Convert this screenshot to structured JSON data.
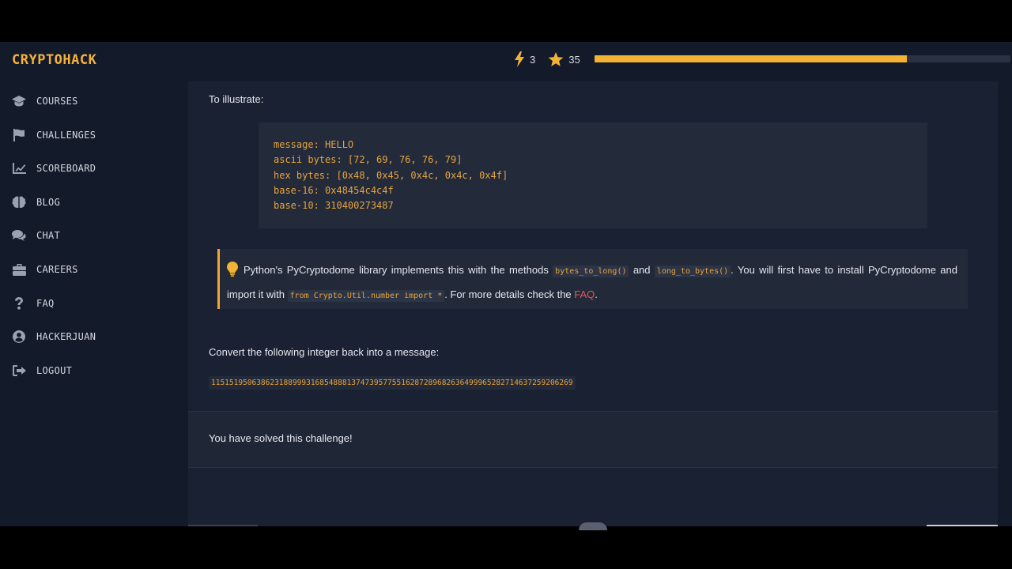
{
  "brand": "CRYPTOHACK",
  "stats": {
    "lightning": "3",
    "stars": "35",
    "progress_percent": 75
  },
  "nav": [
    {
      "label": "COURSES",
      "icon": "graduation-cap-icon"
    },
    {
      "label": "CHALLENGES",
      "icon": "flag-icon"
    },
    {
      "label": "SCOREBOARD",
      "icon": "chart-line-icon"
    },
    {
      "label": "BLOG",
      "icon": "brain-icon"
    },
    {
      "label": "CHAT",
      "icon": "chat-bubbles-icon"
    },
    {
      "label": "CAREERS",
      "icon": "briefcase-icon"
    },
    {
      "label": "FAQ",
      "icon": "question-mark-icon"
    },
    {
      "label": "HACKERJUAN",
      "icon": "user-circle-icon"
    },
    {
      "label": "LOGOUT",
      "icon": "sign-out-icon"
    }
  ],
  "content": {
    "intro": "To illustrate:",
    "code_lines": [
      "message: HELLO",
      "ascii bytes: [72, 69, 76, 76, 79]",
      "hex bytes: [0x48, 0x45, 0x4c, 0x4c, 0x4f]",
      "base-16: 0x48454c4c4f",
      "base-10: 310400273487"
    ],
    "hint": {
      "text1": "Python's PyCryptodome library implements this with the methods",
      "code1": "bytes_to_long()",
      "text2": "and",
      "code2": "long_to_bytes()",
      "text3": ". You will first have to install PyCryptodome and import it with",
      "code3": "from Crypto.Util.number import *",
      "text4": ". For more details check the",
      "link": "FAQ",
      "text5": "."
    },
    "convert": "Convert the following integer back into a message:",
    "number": "11515195063862318899931685488813747395775516287289682636499965282714637259206269",
    "solved": "You have solved this challenge!"
  },
  "colors": {
    "accent": "#f3b234",
    "link": "#e35757",
    "code": "#e6a43f"
  }
}
